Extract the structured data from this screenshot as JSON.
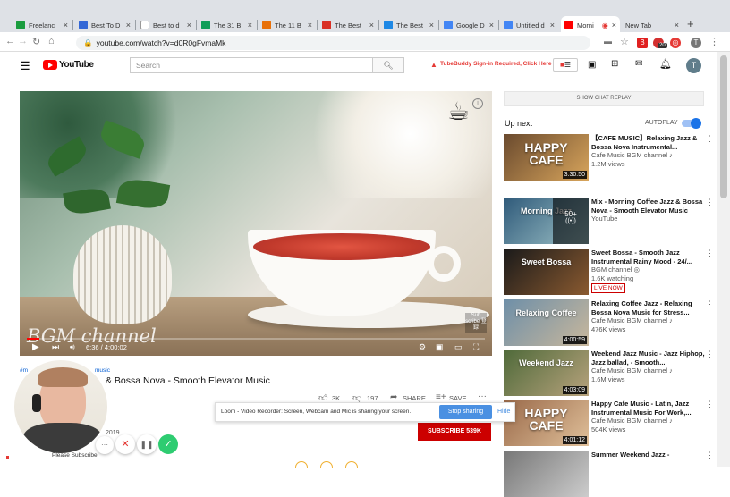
{
  "tabs": [
    {
      "label": "Freelanc",
      "color": "#1a9c3e"
    },
    {
      "label": "Best To D",
      "color": "#3367d6"
    },
    {
      "label": "Best to d",
      "color": "#ffffff"
    },
    {
      "label": "The 31 B",
      "color": "#0f9d58"
    },
    {
      "label": "The 11 B",
      "color": "#e8710a"
    },
    {
      "label": "The Best",
      "color": "#d93025"
    },
    {
      "label": "The Best",
      "color": "#1e88e5"
    },
    {
      "label": "Google D",
      "color": "#4285f4"
    },
    {
      "label": "Untitled d",
      "color": "#4285f4"
    },
    {
      "label": "Morni",
      "color": "#ff0000"
    },
    {
      "label": "New Tab",
      "color": ""
    }
  ],
  "browser": {
    "url": "youtube.com/watch?v=d0R0gFvmaMk",
    "new_tab": "+",
    "ext_badge": "20"
  },
  "youtube": {
    "logo": "YouTube",
    "search_placeholder": "Search",
    "tubebuddy": "TubeBuddy Sign-in Required, Click Here",
    "avatar": "T"
  },
  "video": {
    "time": "6:36 / 4:00:02",
    "watermark": "BGM channel",
    "subscribe_badge": "Sub scribe 登録",
    "hashtags": "#m",
    "hashtag_suffix": "music",
    "title": "& Bossa Nova - Smooth Elevator Music",
    "likes": "3K",
    "dislikes": "197",
    "share": "SHARE",
    "save": "SAVE",
    "year": "2019",
    "subscribe": "SUBSCRIBE  539K"
  },
  "chat": {
    "show_replay": "SHOW CHAT REPLAY"
  },
  "upnext": {
    "heading": "Up next",
    "autoplay": "AUTOPLAY",
    "items": [
      {
        "title": "【CAFE MUSIC】Relaxing Jazz & Bossa Nova Instrumental...",
        "channel": "Cafe Music BGM channel ♪",
        "meta": "1.2M views",
        "duration": "3:30:50",
        "thumb_text": "HAPPY CAFE"
      },
      {
        "title": "Mix - Morning Coffee Jazz & Bossa Nova - Smooth Elevator Music",
        "channel": "YouTube",
        "meta": "",
        "duration": "",
        "thumb_text": "Morning Jazz",
        "mix_count": "50+"
      },
      {
        "title": "Sweet Bossa - Smooth Jazz Instrumental Rainy Mood - 24/...",
        "channel": "BGM channel ◎",
        "meta": "1.6K watching",
        "duration": "",
        "thumb_text": "Sweet Bossa",
        "live": "LIVE NOW"
      },
      {
        "title": "Relaxing Coffee Jazz - Relaxing Bossa Nova Music for Stress...",
        "channel": "Cafe Music BGM channel ♪",
        "meta": "476K views",
        "duration": "4:00:59",
        "thumb_text": "Relaxing Coffee"
      },
      {
        "title": "Weekend Jazz Music - Jazz Hiphop, Jazz ballad, - Smooth...",
        "channel": "Cafe Music BGM channel ♪",
        "meta": "1.6M views",
        "duration": "4:03:09",
        "thumb_text": "Weekend Jazz"
      },
      {
        "title": "Happy Cafe Music - Latin, Jazz Instrumental Music For Work,...",
        "channel": "Cafe Music BGM channel ♪",
        "meta": "504K views",
        "duration": "4:01:12",
        "thumb_text": "HAPPY CAFE"
      },
      {
        "title": "Summer Weekend Jazz -",
        "channel": "",
        "meta": "",
        "duration": "",
        "thumb_text": ""
      }
    ]
  },
  "loom": {
    "message": "Loom - Video Recorder: Screen, Webcam and Mic is sharing your screen.",
    "stop": "Stop sharing",
    "hide": "Hide"
  },
  "webcam": {
    "caption": "Please Subscribe!",
    "more": "···"
  }
}
